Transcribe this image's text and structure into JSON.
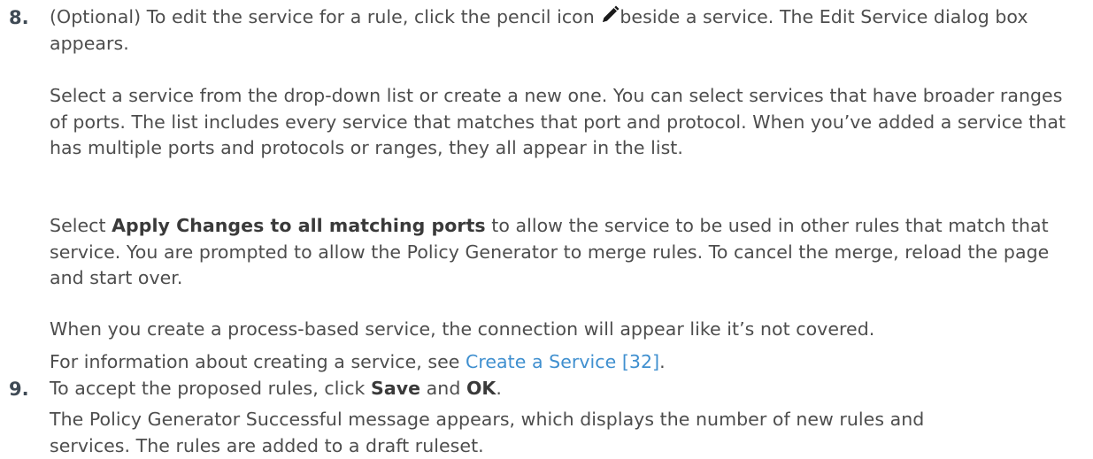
{
  "step8": {
    "number": "8.",
    "intro_before_icon": "(Optional) To edit the service for a rule, click the pencil icon ",
    "icon": "pencil-icon",
    "intro_after_icon": "beside a service. The Edit Service dialog box appears.",
    "para_select": "Select a service from the drop-down list or create a new one. You can select services that have broader ranges of ports. The list includes every service that matches that port and protocol. When you’ve added a service that has multiple ports and protocols or ranges, they all appear in the list.",
    "apply_prefix": "Select ",
    "apply_bold": "Apply Changes to all matching ports",
    "apply_suffix": " to allow the service to be used in other rules that match that service. You are prompted to allow the Policy Generator to merge rules. To cancel the merge, reload the page and start over.",
    "para_process": "When you create a process-based service, the connection will appear like it’s not covered.",
    "info_prefix": "For information about creating a service, see ",
    "info_link": "Create a Service [32]",
    "info_suffix": "."
  },
  "step9": {
    "number": "9.",
    "accept_prefix": "To accept the proposed rules, click ",
    "save_label": "Save",
    "and_text": " and ",
    "ok_label": "OK",
    "accept_suffix": ".",
    "para_success": "The Policy Generator Successful message appears, which displays the number of new rules and services. The rules are added to a draft ruleset."
  },
  "colors": {
    "text": "#4d4d4d",
    "link": "#3f8fcf"
  }
}
